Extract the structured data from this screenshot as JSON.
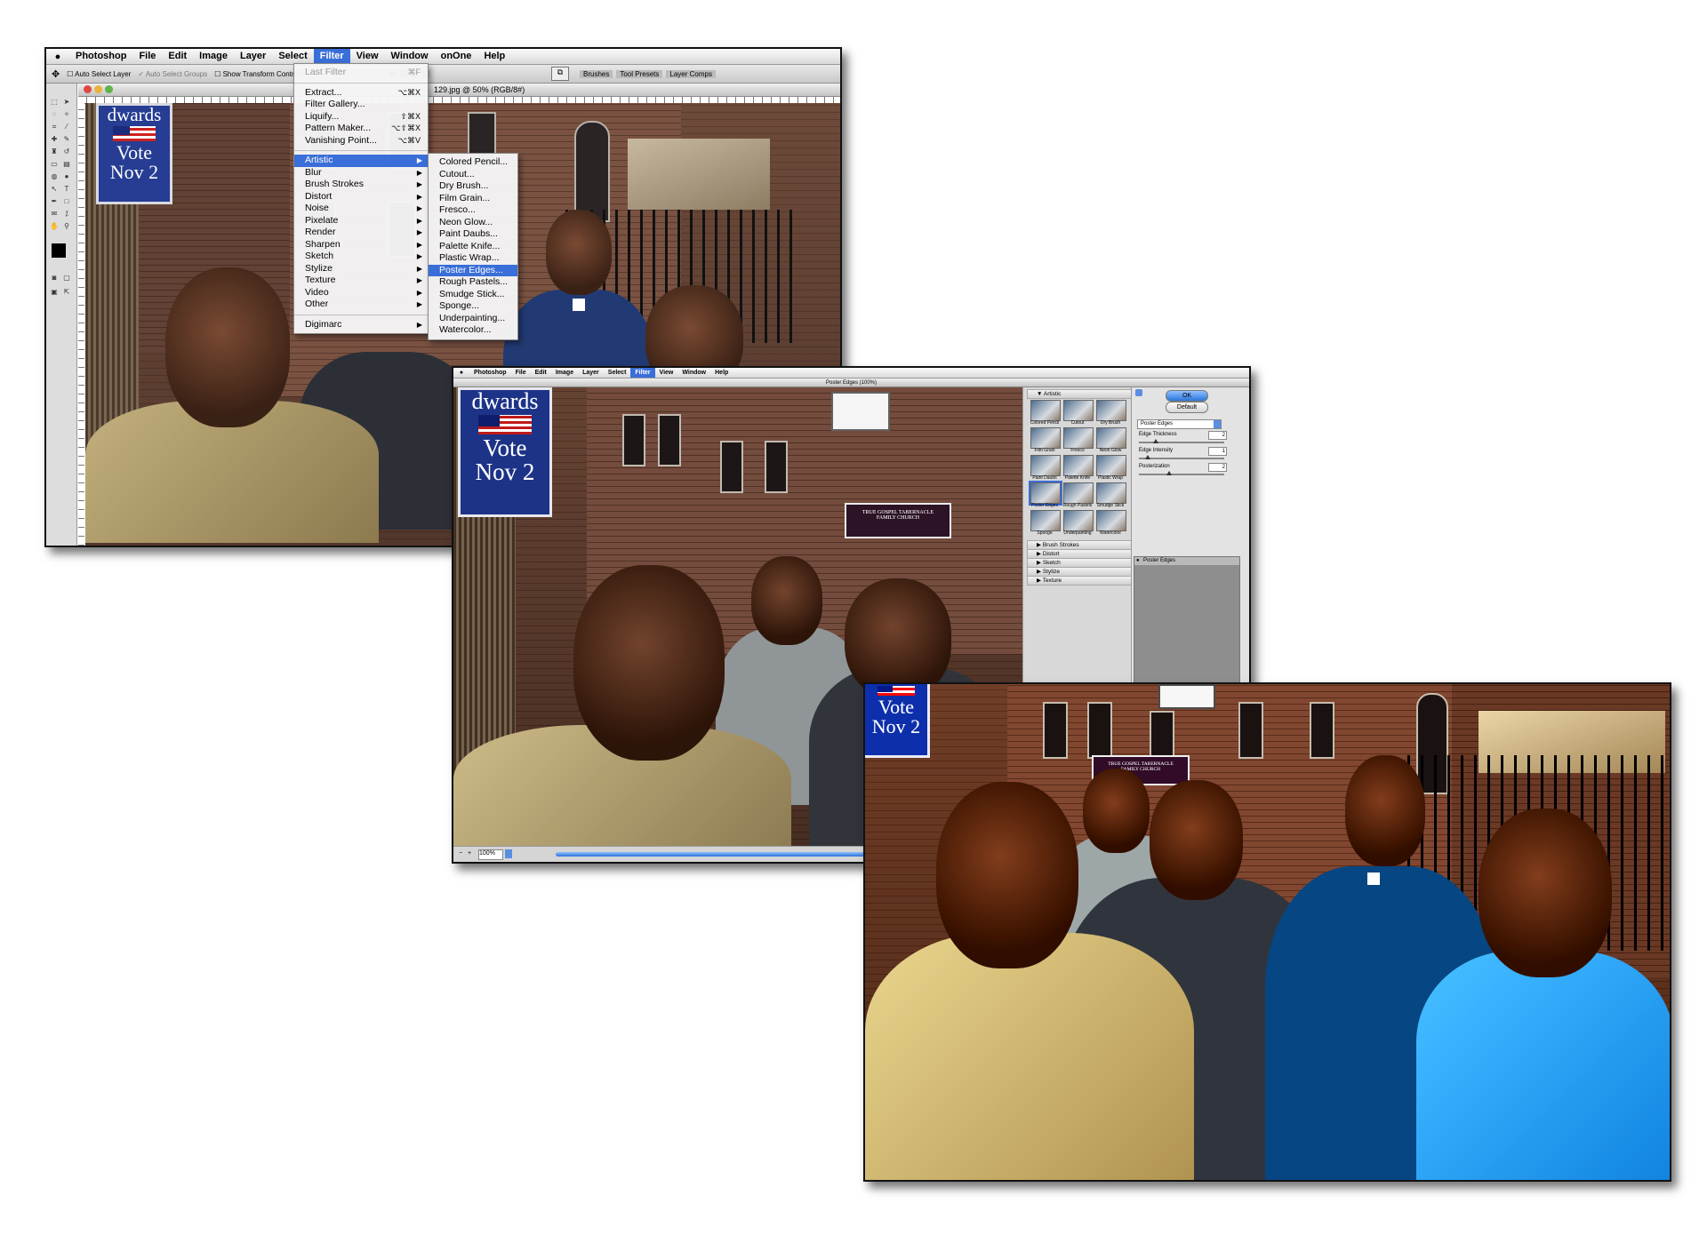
{
  "screenshot1": {
    "menubar": {
      "items": [
        "Photoshop",
        "File",
        "Edit",
        "Image",
        "Layer",
        "Select",
        "Filter",
        "View",
        "Window",
        "onOne",
        "Help"
      ],
      "selected": "Filter"
    },
    "options": {
      "auto_select_layer": "Auto Select Layer",
      "auto_select_groups": "Auto Select Groups",
      "show_transform_controls": "Show Transform Controls"
    },
    "palette_tabs": [
      "Brushes",
      "Tool Presets",
      "Layer Comps"
    ],
    "doc_title": "129.jpg @ 50% (RGB/8#)",
    "filter_menu": {
      "last_filter": "Last Filter",
      "last_filter_shortcut": "⌘F",
      "items": [
        {
          "label": "Extract...",
          "shortcut": "⌥⌘X"
        },
        {
          "label": "Filter Gallery...",
          "shortcut": ""
        },
        {
          "label": "Liquify...",
          "shortcut": "⇧⌘X"
        },
        {
          "label": "Pattern Maker...",
          "shortcut": "⌥⇧⌘X"
        },
        {
          "label": "Vanishing Point...",
          "shortcut": "⌥⌘V"
        }
      ],
      "submenus": [
        "Artistic",
        "Blur",
        "Brush Strokes",
        "Distort",
        "Noise",
        "Pixelate",
        "Render",
        "Sharpen",
        "Sketch",
        "Stylize",
        "Texture",
        "Video",
        "Other"
      ],
      "highlighted": "Artistic",
      "last_item": "Digimarc"
    },
    "artistic_menu": {
      "items": [
        "Colored Pencil...",
        "Cutout...",
        "Dry Brush...",
        "Film Grain...",
        "Fresco...",
        "Neon Glow...",
        "Paint Daubs...",
        "Palette Knife...",
        "Plastic Wrap...",
        "Poster Edges...",
        "Rough Pastels...",
        "Smudge Stick...",
        "Sponge...",
        "Underpainting...",
        "Watercolor..."
      ],
      "highlighted": "Poster Edges..."
    },
    "banner": {
      "line1": "dwards",
      "line2": "Vote",
      "line3": "Nov 2"
    }
  },
  "screenshot2": {
    "menubar": {
      "items": [
        "Photoshop",
        "File",
        "Edit",
        "Image",
        "Layer",
        "Select",
        "Filter",
        "View",
        "Window",
        "Help"
      ],
      "selected": "Filter"
    },
    "dialog_title": "Poster Edges (100%)",
    "banner": {
      "line1": "dwards",
      "line2": "Vote",
      "line3": "Nov 2"
    },
    "church_sign": {
      "line1": "TRUE GOSPEL TABERNACLE",
      "line2": "FAMILY CHURCH"
    },
    "gallery": {
      "category_open": "Artistic",
      "thumbs": [
        "Colored Pencil",
        "Cutout",
        "Dry Brush",
        "Film Grain",
        "Fresco",
        "Neon Glow",
        "Paint Daubs",
        "Palette Knife",
        "Plastic Wrap",
        "Poster Edges",
        "Rough Pastels",
        "Smudge Stick",
        "Sponge",
        "Underpainting",
        "Watercolor"
      ],
      "selected_thumb": "Poster Edges",
      "categories_closed": [
        "Brush Strokes",
        "Distort",
        "Sketch",
        "Stylize",
        "Texture"
      ]
    },
    "controls": {
      "ok_label": "OK",
      "default_label": "Default",
      "filter_select": "Poster Edges",
      "sliders": [
        {
          "label": "Edge Thickness",
          "value": "2",
          "fraction": 0.2
        },
        {
          "label": "Edge Intensity",
          "value": "1",
          "fraction": 0.1
        },
        {
          "label": "Posterization",
          "value": "2",
          "fraction": 0.35
        }
      ],
      "layer_name": "Poster Edges"
    },
    "zoom": "100%"
  },
  "screenshot3": {
    "banner": {
      "line2": "Vote",
      "line3": "Nov 2"
    },
    "church_sign": {
      "line1": "TRUE GOSPEL TABERNACLE",
      "line2": "FAMILY CHURCH"
    }
  },
  "colors": {
    "menu_highlight": "#3a6ed8",
    "banner_blue": "#263d93"
  }
}
